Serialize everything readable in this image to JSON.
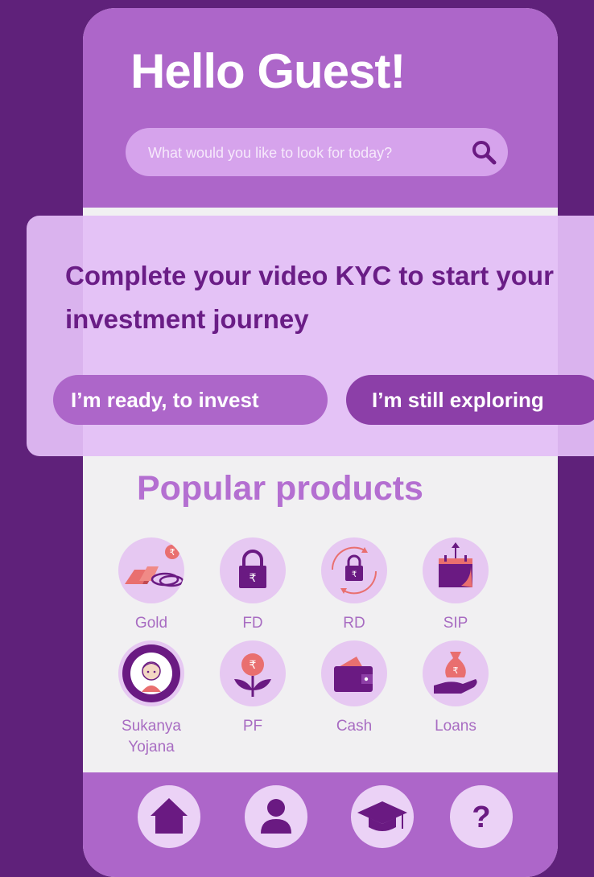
{
  "header": {
    "greeting": "Hello Guest!"
  },
  "search": {
    "placeholder": "What would you like to look for today?"
  },
  "kyc": {
    "message": "Complete your video KYC to start your investment journey",
    "ready_button": "I’m ready, to invest",
    "explore_button": "I’m still exploring"
  },
  "products": {
    "title": "Popular products",
    "items": [
      {
        "label": "Gold",
        "icon": "gold-icon"
      },
      {
        "label": "FD",
        "icon": "lock-rupee-icon"
      },
      {
        "label": "RD",
        "icon": "recurring-lock-icon"
      },
      {
        "label": "SIP",
        "icon": "calendar-growth-icon"
      },
      {
        "label": "Sukanya Yojana",
        "icon": "sukanya-emblem-icon"
      },
      {
        "label": "PF",
        "icon": "rupee-plant-icon"
      },
      {
        "label": "Cash",
        "icon": "wallet-icon"
      },
      {
        "label": "Loans",
        "icon": "money-bag-hand-icon"
      }
    ]
  },
  "nav": {
    "items": [
      {
        "icon": "home-icon"
      },
      {
        "icon": "profile-icon"
      },
      {
        "icon": "graduation-cap-icon"
      },
      {
        "icon": "help-icon"
      }
    ]
  },
  "colors": {
    "background": "#5f217a",
    "accent": "#ad66c9",
    "dark_accent": "#8c3fa8",
    "icon_bg": "#e6c8f2",
    "icon_dark": "#6a1a82"
  }
}
